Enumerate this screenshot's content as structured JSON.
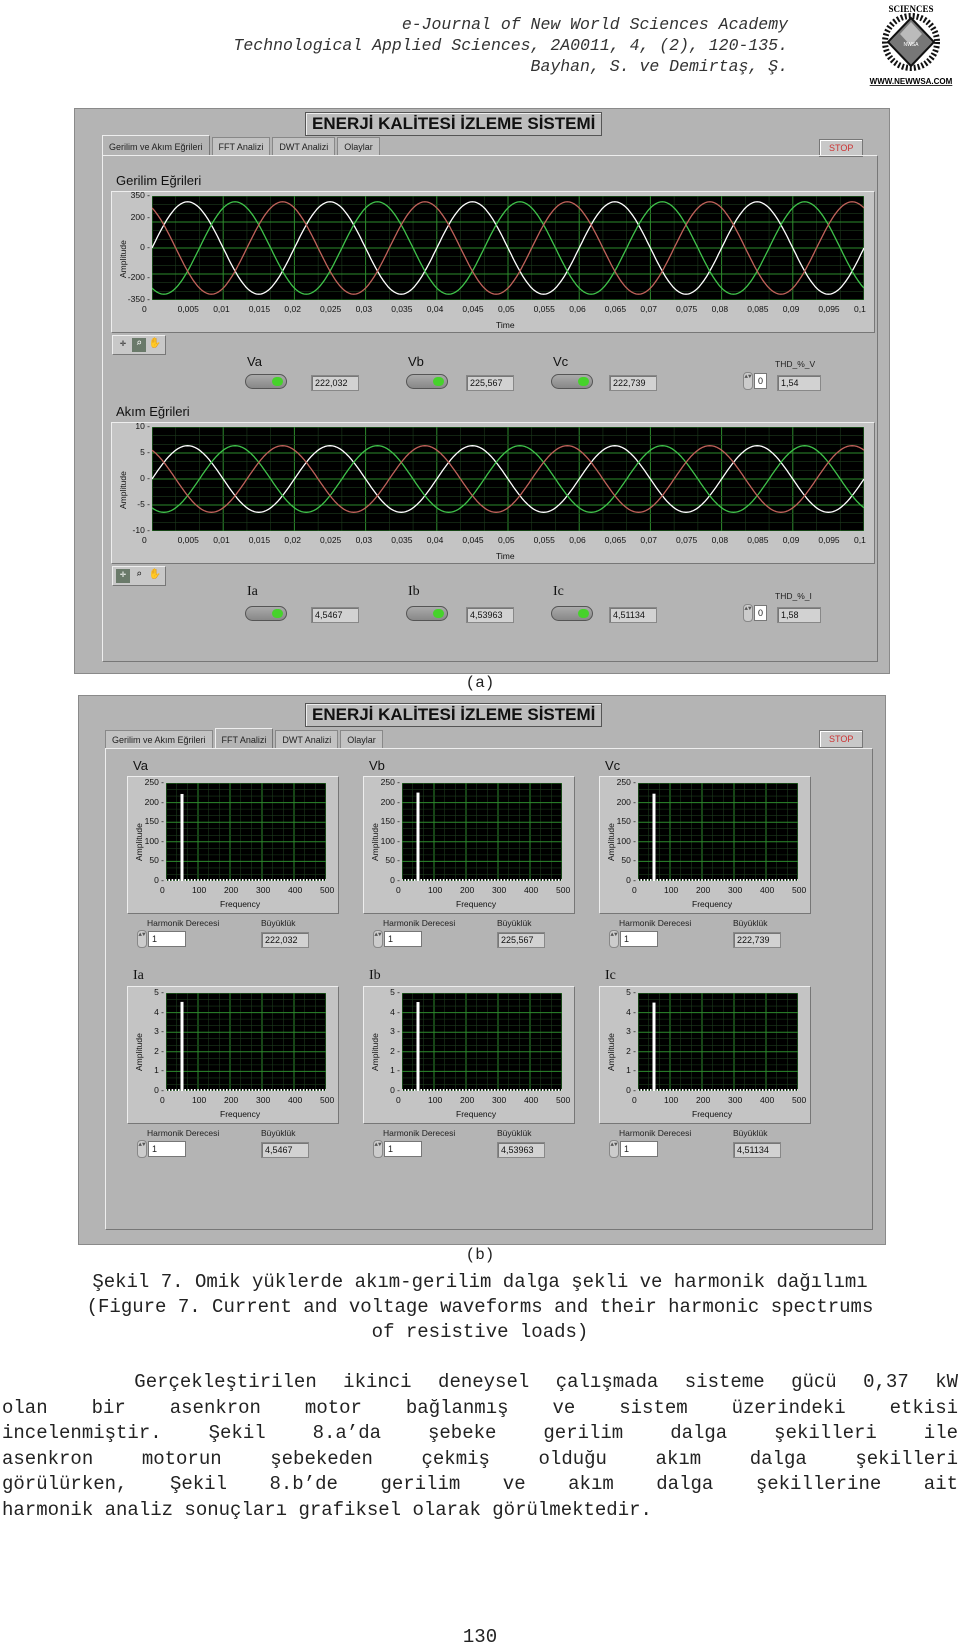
{
  "journal_header": {
    "line1": "e-Journal of New World Sciences Academy",
    "line2": "Technological Applied Sciences, 2A0011, 4, (2), 120-135.",
    "line3": "Bayhan, S. ve Demirtaş, Ş.",
    "logo_top": "SCIENCES",
    "logo_left": "NEW WORLD",
    "logo_right": "ACADEMY",
    "logo_center": "NWSA",
    "logo_url": "WWW.NEWWSA.COM"
  },
  "app": {
    "title": "ENERJİ KALİTESİ İZLEME SİSTEMİ",
    "tabs": [
      "Gerilim ve Akım Eğrileri",
      "FFT Analizi",
      "DWT Analizi",
      "Olaylar"
    ],
    "stop_label": "STOP"
  },
  "figure_a": {
    "active_tab": 0,
    "voltage_section_title": "Gerilim Eğrileri",
    "current_section_title": "Akım Eğrileri",
    "voltage_channels": [
      {
        "label": "Va",
        "value": "222,032"
      },
      {
        "label": "Vb",
        "value": "225,567"
      },
      {
        "label": "Vc",
        "value": "222,739"
      }
    ],
    "current_channels": [
      {
        "label": "Ia",
        "value": "4,5467"
      },
      {
        "label": "Ib",
        "value": "4,53963"
      },
      {
        "label": "Ic",
        "value": "4,51134"
      }
    ],
    "thd_v": {
      "label": "THD_%_V",
      "index": "0",
      "value": "1,54"
    },
    "thd_i": {
      "label": "THD_%_I",
      "index": "0",
      "value": "1,58"
    },
    "toolbar_icons": [
      "cursor-icon",
      "zoom-icon",
      "pan-hand-icon"
    ],
    "caption": "(a)"
  },
  "figure_b": {
    "active_tab": 1,
    "caption": "(b)",
    "harmonic_label": "Harmonik Derecesi",
    "magnitude_label": "Büyüklük",
    "panels": [
      {
        "label": "Va",
        "harmonic": "1",
        "magnitude": "222,032"
      },
      {
        "label": "Vb",
        "harmonic": "1",
        "magnitude": "225,567"
      },
      {
        "label": "Vc",
        "harmonic": "1",
        "magnitude": "222,739"
      },
      {
        "label": "Ia",
        "harmonic": "1",
        "magnitude": "4,5467"
      },
      {
        "label": "Ib",
        "harmonic": "1",
        "magnitude": "4,53963"
      },
      {
        "label": "Ic",
        "harmonic": "1",
        "magnitude": "4,51134"
      }
    ]
  },
  "chart_data": [
    {
      "type": "line",
      "title": "Gerilim Eğrileri",
      "xlabel": "Time",
      "ylabel": "Amplitude",
      "xlim": [
        0,
        0.1
      ],
      "ylim": [
        -350,
        350
      ],
      "xticks": [
        "0",
        "0,005",
        "0,01",
        "0,015",
        "0,02",
        "0,025",
        "0,03",
        "0,035",
        "0,04",
        "0,045",
        "0,05",
        "0,055",
        "0,06",
        "0,065",
        "0,07",
        "0,075",
        "0,08",
        "0,085",
        "0,09",
        "0,095",
        "0,1"
      ],
      "yticks": [
        "350",
        "200",
        "0",
        "-200",
        "-350"
      ],
      "ytick_values": [
        350,
        200,
        0,
        -200,
        -350
      ],
      "grid": true,
      "frequency_hz": 50,
      "series": [
        {
          "name": "Va",
          "color": "#ffffff",
          "amplitude": 311,
          "phase_deg": 0
        },
        {
          "name": "Vb",
          "color": "#3fc24a",
          "amplitude": 311,
          "phase_deg": -120
        },
        {
          "name": "Vc",
          "color": "#c0625a",
          "amplitude": 311,
          "phase_deg": 120
        }
      ]
    },
    {
      "type": "line",
      "title": "Akım Eğrileri",
      "xlabel": "Time",
      "ylabel": "Amplitude",
      "xlim": [
        0,
        0.1
      ],
      "ylim": [
        -10,
        10
      ],
      "xticks": [
        "0",
        "0,005",
        "0,01",
        "0,015",
        "0,02",
        "0,025",
        "0,03",
        "0,035",
        "0,04",
        "0,045",
        "0,05",
        "0,055",
        "0,06",
        "0,065",
        "0,07",
        "0,075",
        "0,08",
        "0,085",
        "0,09",
        "0,095",
        "0,1"
      ],
      "yticks": [
        "10",
        "5",
        "0",
        "-5",
        "-10"
      ],
      "ytick_values": [
        10,
        5,
        0,
        -5,
        -10
      ],
      "grid": true,
      "frequency_hz": 50,
      "series": [
        {
          "name": "Ia",
          "color": "#ffffff",
          "amplitude": 6.4,
          "phase_deg": 0
        },
        {
          "name": "Ib",
          "color": "#3fc24a",
          "amplitude": 6.4,
          "phase_deg": -120
        },
        {
          "name": "Ic",
          "color": "#c0625a",
          "amplitude": 6.4,
          "phase_deg": 120
        }
      ]
    },
    {
      "type": "bar",
      "title": "Va",
      "xlabel": "Frequency",
      "ylabel": "Amplitude",
      "xlim": [
        0,
        500
      ],
      "ylim": [
        0,
        250
      ],
      "xticks": [
        "0",
        "100",
        "200",
        "300",
        "400",
        "500"
      ],
      "yticks": [
        "250",
        "200",
        "150",
        "100",
        "50",
        "0"
      ],
      "ytick_values": [
        250,
        200,
        150,
        100,
        50,
        0
      ],
      "bars": [
        {
          "x": 50,
          "y": 222.032
        }
      ]
    },
    {
      "type": "bar",
      "title": "Vb",
      "xlabel": "Frequency",
      "ylabel": "Amplitude",
      "xlim": [
        0,
        500
      ],
      "ylim": [
        0,
        250
      ],
      "xticks": [
        "0",
        "100",
        "200",
        "300",
        "400",
        "500"
      ],
      "yticks": [
        "250",
        "200",
        "150",
        "100",
        "50",
        "0"
      ],
      "ytick_values": [
        250,
        200,
        150,
        100,
        50,
        0
      ],
      "bars": [
        {
          "x": 50,
          "y": 225.567
        }
      ]
    },
    {
      "type": "bar",
      "title": "Vc",
      "xlabel": "Frequency",
      "ylabel": "Amplitude",
      "xlim": [
        0,
        500
      ],
      "ylim": [
        0,
        250
      ],
      "xticks": [
        "0",
        "100",
        "200",
        "300",
        "400",
        "500"
      ],
      "yticks": [
        "250",
        "200",
        "150",
        "100",
        "50",
        "0"
      ],
      "ytick_values": [
        250,
        200,
        150,
        100,
        50,
        0
      ],
      "bars": [
        {
          "x": 50,
          "y": 222.739
        }
      ]
    },
    {
      "type": "bar",
      "title": "Ia",
      "xlabel": "Frequency",
      "ylabel": "Amplitude",
      "xlim": [
        0,
        500
      ],
      "ylim": [
        0,
        5
      ],
      "xticks": [
        "0",
        "100",
        "200",
        "300",
        "400",
        "500"
      ],
      "yticks": [
        "5",
        "4",
        "3",
        "2",
        "1",
        "0"
      ],
      "ytick_values": [
        5,
        4,
        3,
        2,
        1,
        0
      ],
      "bars": [
        {
          "x": 50,
          "y": 4.5467
        }
      ]
    },
    {
      "type": "bar",
      "title": "Ib",
      "xlabel": "Frequency",
      "ylabel": "Amplitude",
      "xlim": [
        0,
        500
      ],
      "ylim": [
        0,
        5
      ],
      "xticks": [
        "0",
        "100",
        "200",
        "300",
        "400",
        "500"
      ],
      "yticks": [
        "5",
        "4",
        "3",
        "2",
        "1",
        "0"
      ],
      "ytick_values": [
        5,
        4,
        3,
        2,
        1,
        0
      ],
      "bars": [
        {
          "x": 50,
          "y": 4.53963
        }
      ]
    },
    {
      "type": "bar",
      "title": "Ic",
      "xlabel": "Frequency",
      "ylabel": "Amplitude",
      "xlim": [
        0,
        500
      ],
      "ylim": [
        0,
        5
      ],
      "xticks": [
        "0",
        "100",
        "200",
        "300",
        "400",
        "500"
      ],
      "yticks": [
        "5",
        "4",
        "3",
        "2",
        "1",
        "0"
      ],
      "ytick_values": [
        5,
        4,
        3,
        2,
        1,
        0
      ],
      "bars": [
        {
          "x": 50,
          "y": 4.51134
        }
      ]
    }
  ],
  "caption": {
    "line1": "Şekil 7. Omik yüklerde akım-gerilim dalga şekli ve harmonik dağılımı",
    "line2": "(Figure 7. Current and voltage waveforms and their harmonic spectrums",
    "line3": "of resistive loads)"
  },
  "paragraph": {
    "lines": [
      "     Gerçekleştirilen ikinci deneysel çalışmada sisteme gücü 0,37 kW",
      "olan bir asenkron motor bağlanmış ve sistem üzerindeki etkisi",
      "incelenmiştir. Şekil 8.a’da şebeke gerilim dalga şekilleri ile",
      "asenkron motorun şebekeden çekmiş olduğu akım dalga şekilleri",
      "görülürken, Şekil 8.b’de gerilim ve akım dalga şekillerine ait",
      "harmonik analiz sonuçları grafiksel olarak görülmektedir."
    ]
  },
  "page_number": "130"
}
